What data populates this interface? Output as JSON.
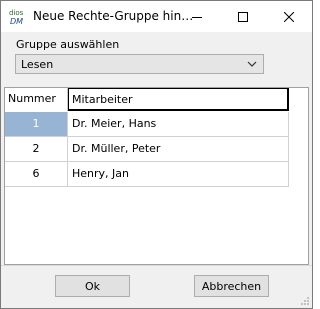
{
  "window": {
    "title": "Neue Rechte-Gruppe hin…",
    "app_icon_top": "dios",
    "app_icon_bottom": "DM"
  },
  "form": {
    "group_label": "Gruppe auswählen",
    "group_select_value": "Lesen"
  },
  "table": {
    "headers": [
      "Nummer",
      "Mitarbeiter"
    ],
    "rows": [
      {
        "number": "1",
        "name": "Dr. Meier, Hans"
      },
      {
        "number": "2",
        "name": "Dr. Müller, Peter"
      },
      {
        "number": "6",
        "name": "Henry, Jan"
      }
    ]
  },
  "buttons": {
    "ok": "Ok",
    "cancel": "Abbrechen"
  },
  "colors": {
    "selected_cell": "#98b4d4",
    "dialog_bg": "#f0f0f0"
  }
}
